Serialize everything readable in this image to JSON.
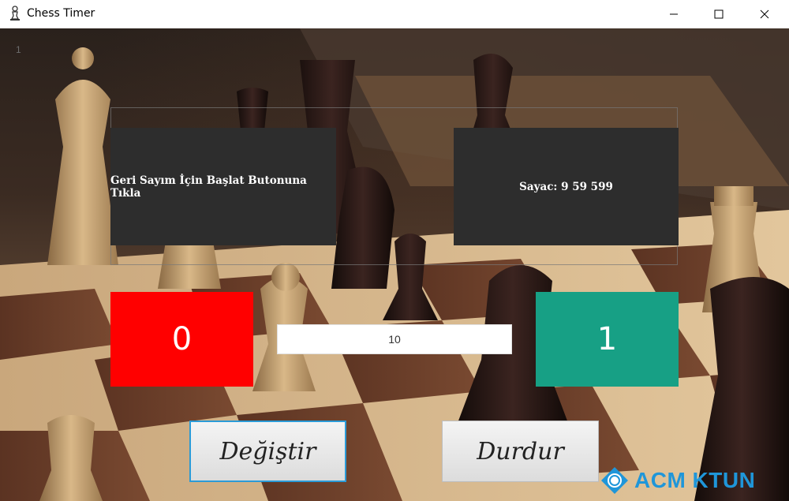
{
  "window": {
    "title": "Chess Timer",
    "icon": "chess-pawn-icon"
  },
  "canvas": {
    "corner_label": "1"
  },
  "panels": {
    "left_text": "Geri Sayım İçin Başlat Butonuna Tıkla",
    "right_text": "Sayac: 9 59 599"
  },
  "scores": {
    "left": "0",
    "right": "1",
    "left_color": "#ff0000",
    "right_color": "#17a085"
  },
  "input": {
    "value": "10"
  },
  "buttons": {
    "change_label": "Değiştir",
    "stop_label": "Durdur"
  },
  "brand": {
    "text": "ACM KTUN",
    "color": "#1f96d9"
  }
}
